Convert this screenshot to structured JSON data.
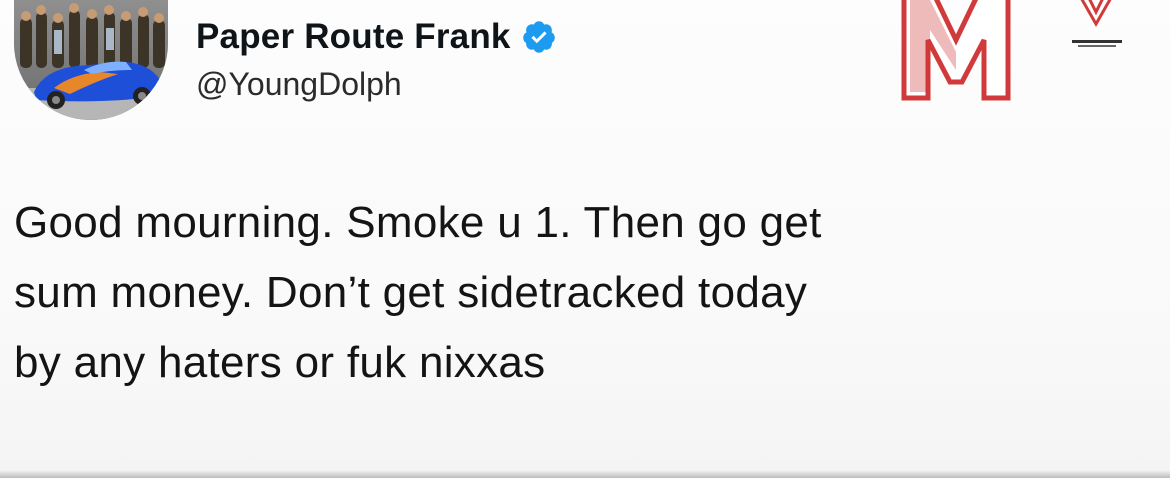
{
  "author": {
    "display_name": "Paper Route Frank",
    "handle": "@YoungDolph",
    "verified": true,
    "verified_icon": "verified-badge-icon",
    "verified_color": "#1d9bf0",
    "avatar": "avatar-image-icon"
  },
  "tweet": {
    "lines": [
      "Good mourning. Smoke u 1. Then go get",
      "sum money. Don’t get sidetracked today",
      "by any haters or fuk nixxas"
    ]
  },
  "watermark": {
    "icon": "m-logo-watermark-icon",
    "letter": "M",
    "color": "#d13a3a"
  },
  "colors": {
    "background": "#fbfbfb",
    "text": "#0f1419",
    "handle": "#2b2b2b"
  }
}
